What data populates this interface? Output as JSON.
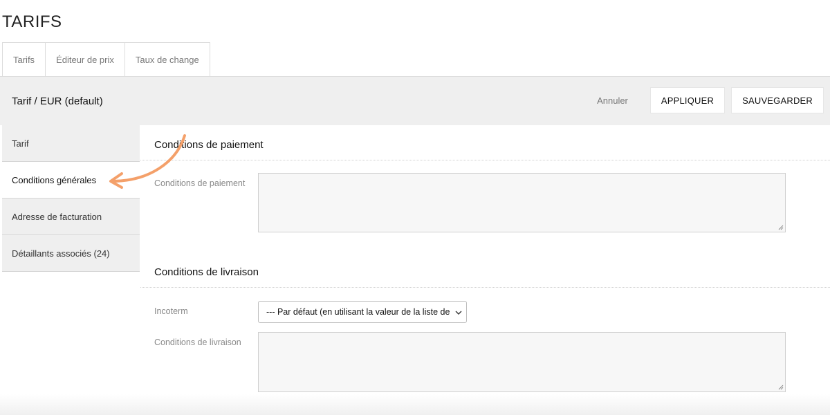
{
  "page": {
    "title": "TARIFS"
  },
  "tabs": [
    {
      "label": "Tarifs"
    },
    {
      "label": "Éditeur de prix"
    },
    {
      "label": "Taux de change"
    }
  ],
  "header": {
    "title": "Tarif / EUR (default)",
    "cancel_label": "Annuler",
    "apply_label": "APPLIQUER",
    "save_label": "SAUVEGARDER"
  },
  "sidebar": {
    "items": [
      {
        "label": "Tarif",
        "active": false
      },
      {
        "label": "Conditions générales",
        "active": true
      },
      {
        "label": "Adresse de facturation",
        "active": false
      },
      {
        "label": "Détaillants associés (24)",
        "active": false
      }
    ]
  },
  "payment": {
    "section_title": "Conditions de paiement",
    "field_label": "Conditions de paiement",
    "value": ""
  },
  "delivery": {
    "section_title": "Conditions de livraison",
    "incoterm_label": "Incoterm",
    "incoterm_value": "--- Par défaut (en utilisant la valeur de la liste de",
    "field_label": "Conditions de livraison",
    "value": ""
  },
  "colors": {
    "annotation_arrow": "#f4a06a",
    "header_bg": "#efefef",
    "sidebar_bg": "#efefef"
  },
  "icons": {
    "select_chevron": "chevron-down-icon",
    "resize_grip": "resize-grip-icon",
    "annotation": "curved-arrow-icon"
  }
}
